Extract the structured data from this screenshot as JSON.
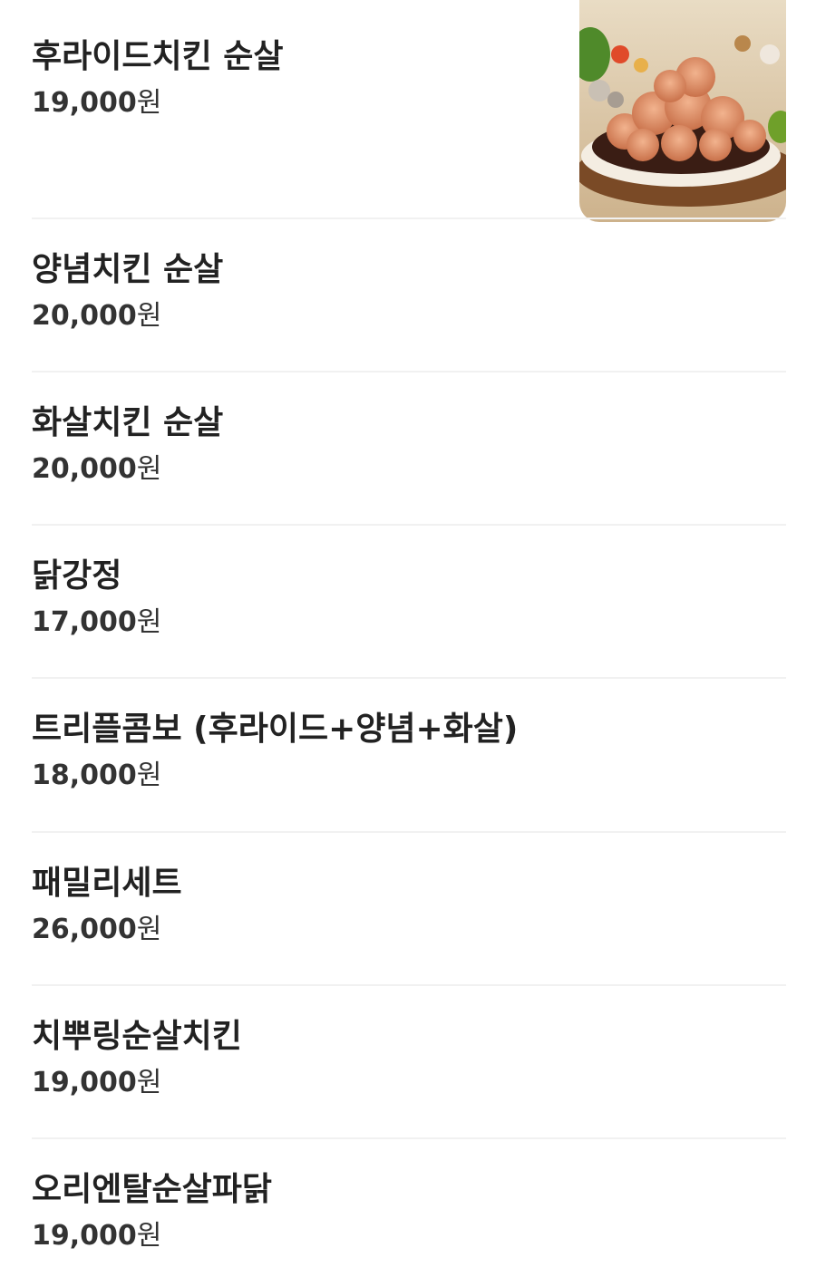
{
  "menu": {
    "currency_suffix": "원",
    "items": [
      {
        "name": "후라이드치킨 순살",
        "price": "19,000"
      },
      {
        "name": "양념치킨 순살",
        "price": "20,000"
      },
      {
        "name": "화살치킨 순살",
        "price": "20,000"
      },
      {
        "name": "닭강정",
        "price": "17,000"
      },
      {
        "name": "트리플콤보 (후라이드+양념+화살)",
        "price": "18,000"
      },
      {
        "name": "패밀리세트",
        "price": "26,000"
      },
      {
        "name": "치뿌링순살치킨",
        "price": "19,000"
      },
      {
        "name": "오리엔탈순살파닭",
        "price": "19,000"
      }
    ]
  }
}
